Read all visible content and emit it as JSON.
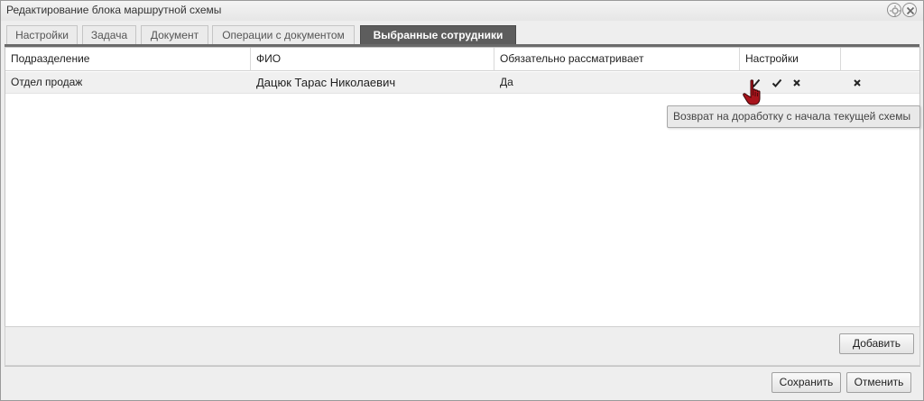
{
  "window": {
    "title": "Редактирование блока маршрутной схемы"
  },
  "tabs": [
    {
      "label": "Настройки",
      "active": false
    },
    {
      "label": "Задача",
      "active": false
    },
    {
      "label": "Документ",
      "active": false
    },
    {
      "label": "Операции с документом",
      "active": false
    },
    {
      "label": "Выбранные сотрудники",
      "active": true
    }
  ],
  "grid": {
    "columns": [
      "Подразделение",
      "ФИО",
      "Обязательно рассматривает",
      "Настройки",
      ""
    ],
    "rows": [
      {
        "department": "Отдел продаж",
        "name": "Дацюк Тарас Николаевич",
        "mandatory": "Да",
        "actions": [
          "return-icon",
          "check-icon",
          "cross-icon",
          "delete-icon"
        ]
      }
    ]
  },
  "tooltip": {
    "text": "Возврат на доработку с начала текущей схемы"
  },
  "buttons": {
    "add": "Добавить",
    "save": "Сохранить",
    "cancel": "Отменить"
  },
  "colors": {
    "active_tab": "#5d5d5d",
    "row_highlight": "#f0f0f0",
    "cursor": "#a8141c"
  }
}
